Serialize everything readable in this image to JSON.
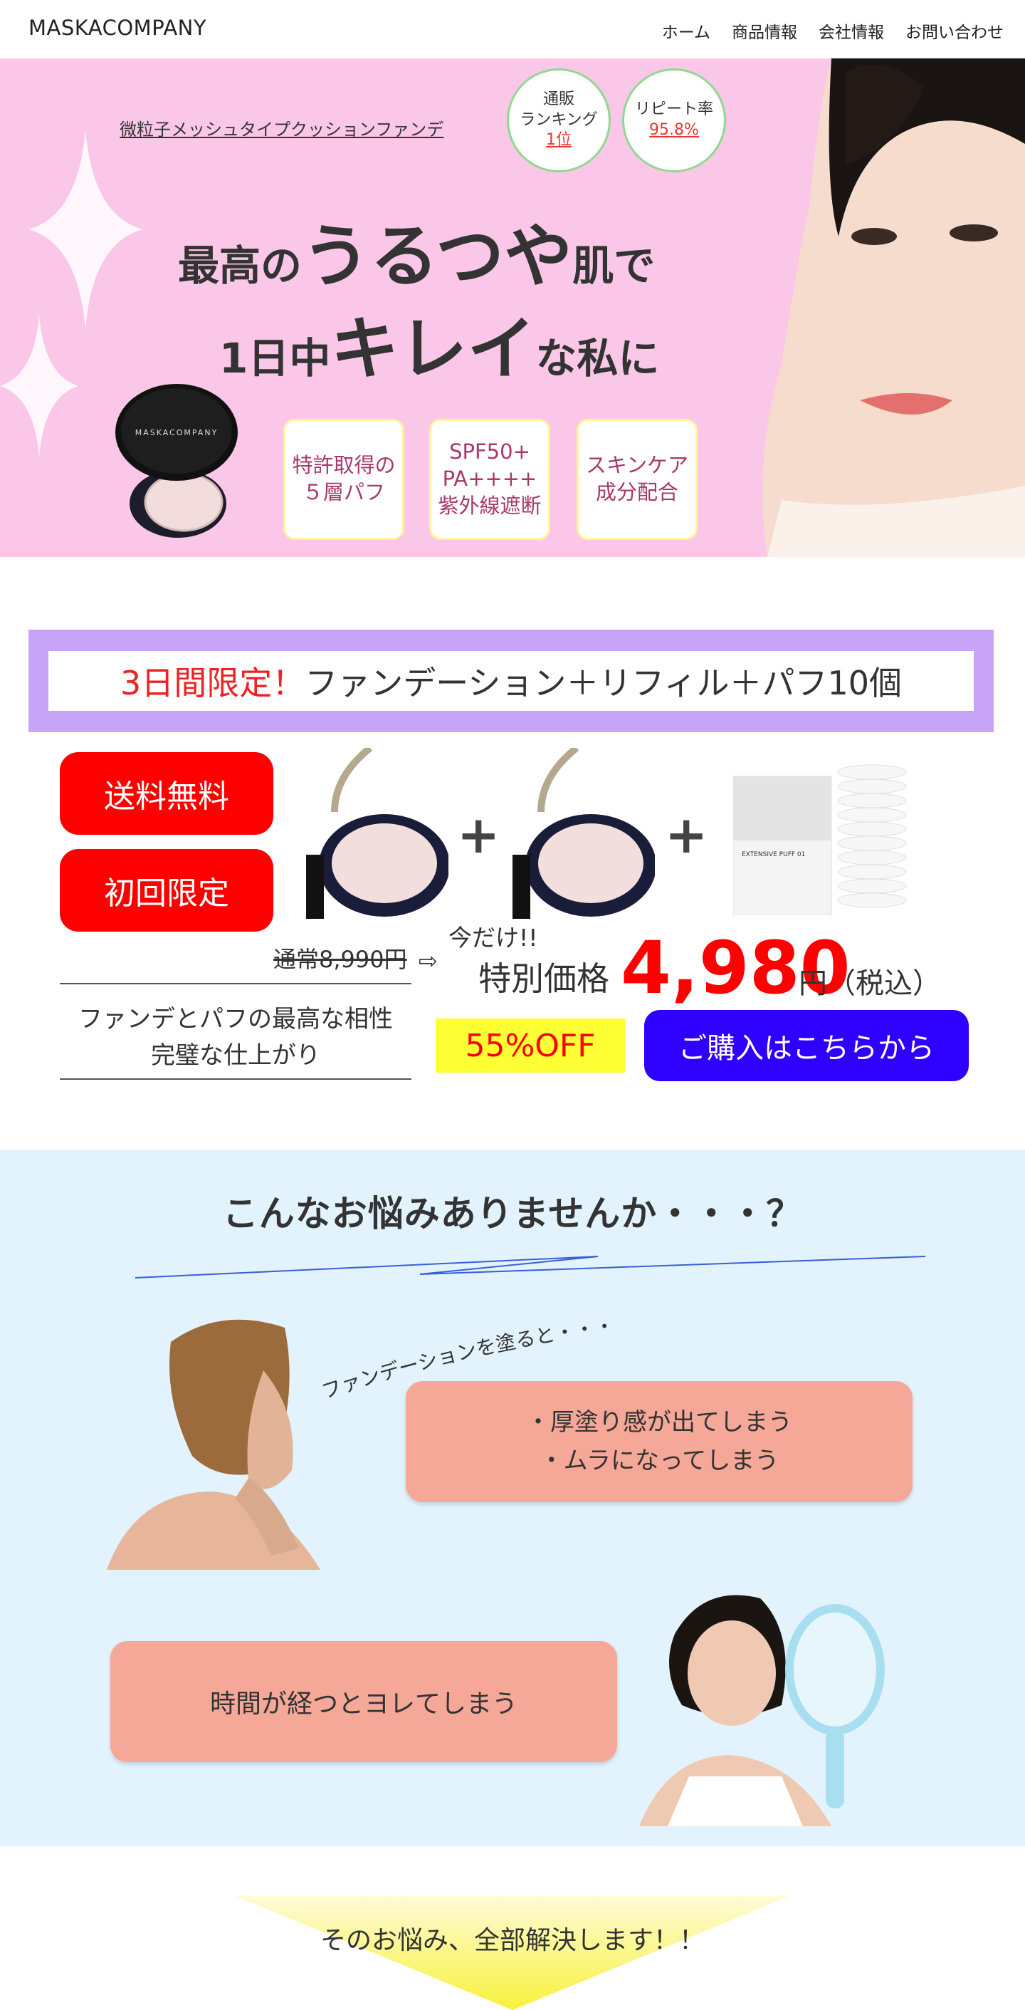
{
  "header": {
    "logo": "MASKACOMPANY",
    "nav": [
      "ホーム",
      "商品情報",
      "会社情報",
      "お問い合わせ"
    ]
  },
  "hero": {
    "subtitle": "微粒子メッシュタイプクッションファンデ",
    "badge1": {
      "line1": "通販",
      "line2": "ランキング",
      "value": "1位"
    },
    "badge2": {
      "line1": "リピート率",
      "value": "95.8%"
    },
    "headline1": {
      "a": "最高の",
      "b": "うるつや",
      "c": "肌で"
    },
    "headline2": {
      "a": "1日中",
      "b": "キレイ",
      "c": "な私に"
    },
    "features": [
      {
        "line1": "特許取得の",
        "line2": "５層パフ",
        "line3": ""
      },
      {
        "line1": "SPF50+",
        "line2": "PA++++",
        "line3": "紫外線遮断"
      },
      {
        "line1": "スキンケア",
        "line2": "成分配合",
        "line3": ""
      }
    ],
    "compact_brand": "MASKACOMPANY"
  },
  "offer": {
    "banner_red": "3日間限定！",
    "banner_rest": "ファンデーション＋リフィル＋パフ10個",
    "pill1": "送料無料",
    "pill2": "初回限定",
    "regular": "通常8,990円",
    "arrow": "⇨",
    "today": "今だけ!!",
    "special": "特別価格",
    "price": "4,980",
    "yen": "円（税込）",
    "tagline1": "ファンデとパフの最高な相性",
    "tagline2": "完璧な仕上がり",
    "off": "55%OFF",
    "buy": "ご購入はこちらから",
    "puff_box_label": "EXTENSIVE PUFF 01"
  },
  "worries": {
    "title": "こんなお悩みありませんか・・・？",
    "curved": "ファンデーションを塗ると・・・",
    "bubble1_line1": "・厚塗り感が出てしまう",
    "bubble1_line2": "・ムラになってしまう",
    "bubble2": "時間が経つとヨレてしまう"
  },
  "solve": {
    "text": "そのお悩み、全部解決します！！"
  },
  "colors": {
    "hero_bg": "#fbc7e8",
    "offer_banner": "#c7a4f7",
    "accent_red": "#ff0000",
    "buy_blue": "#2d00ff",
    "off_yellow": "#ffff36",
    "worries_bg": "#e2f3fd",
    "bubble": "#f5a898"
  }
}
